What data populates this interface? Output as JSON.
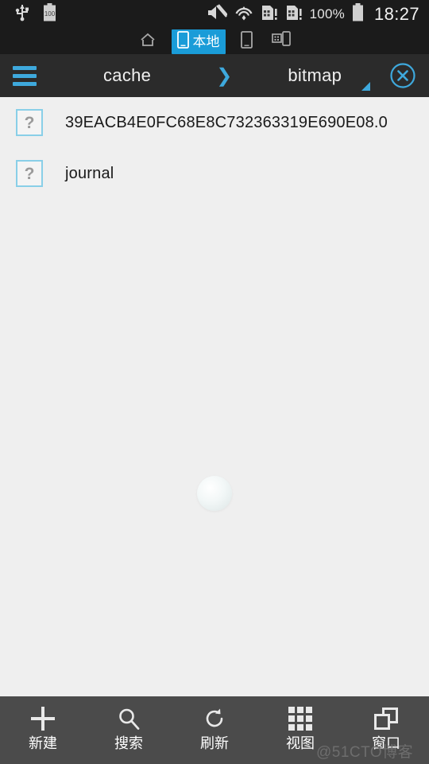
{
  "status_bar": {
    "usb_icon": "usb-icon",
    "battery_badge_icon": "battery-charge-icon",
    "battery_badge_text": "100",
    "mute_icon": "mute-icon",
    "wifi_icon": "wifi-icon",
    "sim1_icon": "sim1-alert-icon",
    "sim2_icon": "sim2-alert-icon",
    "battery_percent": "100%",
    "battery_icon": "battery-full-icon",
    "clock": "18:27"
  },
  "tab_strip": {
    "items": [
      {
        "label": "",
        "icon": "home-icon",
        "active": false
      },
      {
        "label": "本地",
        "icon": "phone-icon",
        "active": true
      },
      {
        "label": "",
        "icon": "tablet-icon",
        "active": false
      },
      {
        "label": "",
        "icon": "network-devices-icon",
        "active": false
      }
    ]
  },
  "toolbar": {
    "menu_icon": "hamburger-menu-icon",
    "breadcrumb": [
      "cache",
      "bitmap"
    ],
    "separator": "❯",
    "dropdown_marker_icon": "triangle-marker-icon",
    "close_icon": "close-circle-icon",
    "accent_color": "#3ea9dd"
  },
  "file_list": {
    "items": [
      {
        "name": "39EACB4E0FC68E8C732363319E690E08.0",
        "icon": "unknown-file-icon",
        "glyph": "?"
      },
      {
        "name": "journal",
        "icon": "unknown-file-icon",
        "glyph": "?"
      }
    ]
  },
  "loading": {
    "icon": "loading-spinner"
  },
  "bottom_bar": {
    "items": [
      {
        "label": "新建",
        "icon": "plus-icon"
      },
      {
        "label": "搜索",
        "icon": "search-icon"
      },
      {
        "label": "刷新",
        "icon": "refresh-icon"
      },
      {
        "label": "视图",
        "icon": "grid-view-icon"
      },
      {
        "label": "窗口",
        "icon": "windows-icon"
      }
    ]
  },
  "watermark": {
    "text": "@51CTO博客"
  }
}
